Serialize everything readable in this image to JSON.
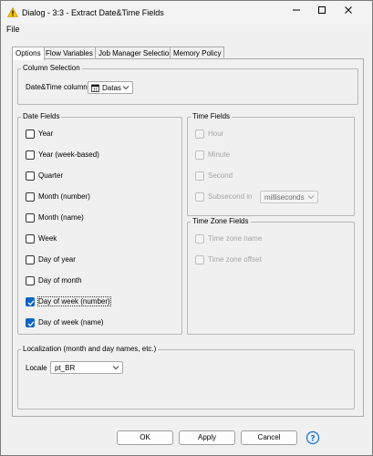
{
  "window": {
    "title": "Dialog - 3:3 - Extract Date&Time Fields",
    "app_icon": "warning-triangle-icon",
    "controls": [
      "minimize-icon",
      "maximize-icon",
      "close-icon"
    ]
  },
  "menu": {
    "file": "File"
  },
  "tabs": [
    {
      "label": "Options",
      "active": true
    },
    {
      "label": "Flow Variables",
      "active": false
    },
    {
      "label": "Job Manager Selection",
      "active": false
    },
    {
      "label": "Memory Policy",
      "active": false
    }
  ],
  "column_selection": {
    "title": "Column Selection",
    "label": "Date&Time column",
    "value": "Datas",
    "icon": "calendar-icon"
  },
  "date_fields": {
    "title": "Date Fields",
    "items": [
      {
        "label": "Year",
        "checked": false
      },
      {
        "label": "Year (week-based)",
        "checked": false
      },
      {
        "label": "Quarter",
        "checked": false
      },
      {
        "label": "Month (number)",
        "checked": false
      },
      {
        "label": "Month (name)",
        "checked": false
      },
      {
        "label": "Week",
        "checked": false
      },
      {
        "label": "Day of year",
        "checked": false
      },
      {
        "label": "Day of month",
        "checked": false
      },
      {
        "label": "Day of week (number)",
        "checked": true
      },
      {
        "label": "Day of week (name)",
        "checked": true
      }
    ]
  },
  "time_fields": {
    "title": "Time Fields",
    "items": [
      {
        "label": "Hour",
        "checked": false,
        "disabled": true
      },
      {
        "label": "Minute",
        "checked": false,
        "disabled": true
      },
      {
        "label": "Second",
        "checked": false,
        "disabled": true
      },
      {
        "label": "Subsecond in",
        "checked": false,
        "disabled": true
      }
    ],
    "subsecond_unit": "milliseconds"
  },
  "time_zone_fields": {
    "title": "Time Zone Fields",
    "items": [
      {
        "label": "Time zone name",
        "checked": false,
        "disabled": true
      },
      {
        "label": "Time zone offset",
        "checked": false,
        "disabled": true
      }
    ]
  },
  "localization": {
    "title": "Localization (month and day names, etc.)",
    "label": "Locale",
    "value": "pt_BR"
  },
  "buttons": {
    "ok": "OK",
    "apply": "Apply",
    "cancel": "Cancel",
    "help_icon": "help-question-icon"
  }
}
